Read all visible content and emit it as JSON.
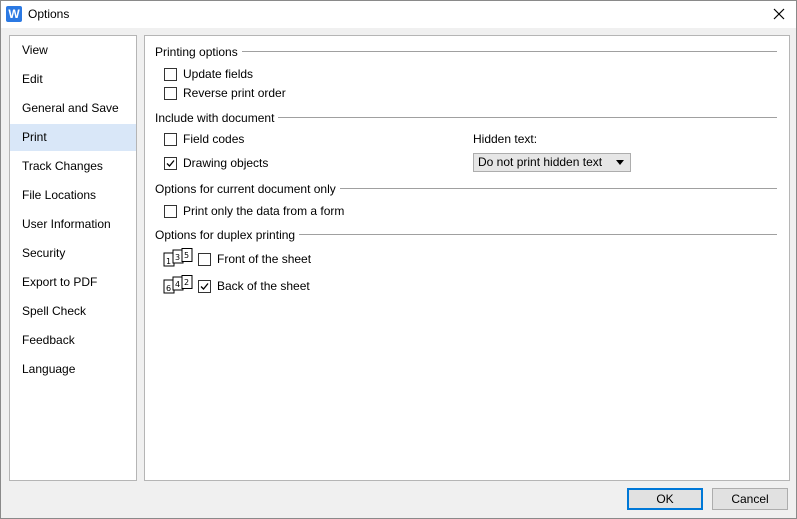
{
  "window": {
    "title": "Options",
    "app_icon_letter": "W"
  },
  "sidebar": {
    "items": [
      {
        "label": "View"
      },
      {
        "label": "Edit"
      },
      {
        "label": "General and Save"
      },
      {
        "label": "Print",
        "active": true
      },
      {
        "label": "Track Changes"
      },
      {
        "label": "File Locations"
      },
      {
        "label": "User Information"
      },
      {
        "label": "Security"
      },
      {
        "label": "Export to PDF"
      },
      {
        "label": "Spell Check"
      },
      {
        "label": "Feedback"
      },
      {
        "label": "Language"
      }
    ]
  },
  "printing_options": {
    "title": "Printing options",
    "update_fields": {
      "label": "Update fields",
      "checked": false
    },
    "reverse_print_order": {
      "label": "Reverse print order",
      "checked": false
    }
  },
  "include_with_document": {
    "title": "Include with document",
    "field_codes": {
      "label": "Field codes",
      "checked": false
    },
    "drawing_objects": {
      "label": "Drawing objects",
      "checked": true
    },
    "hidden_text_label": "Hidden text:",
    "hidden_text_value": "Do not print hidden text"
  },
  "current_document": {
    "title": "Options for current document only",
    "print_form_data": {
      "label": "Print only the data from a form",
      "checked": false
    }
  },
  "duplex": {
    "title": "Options for duplex printing",
    "front_pages": [
      "1",
      "3",
      "5"
    ],
    "back_pages": [
      "6",
      "4",
      "2"
    ],
    "front_of_sheet": {
      "label": "Front of the sheet",
      "checked": false
    },
    "back_of_sheet": {
      "label": "Back of the sheet",
      "checked": true
    }
  },
  "buttons": {
    "ok": "OK",
    "cancel": "Cancel"
  }
}
